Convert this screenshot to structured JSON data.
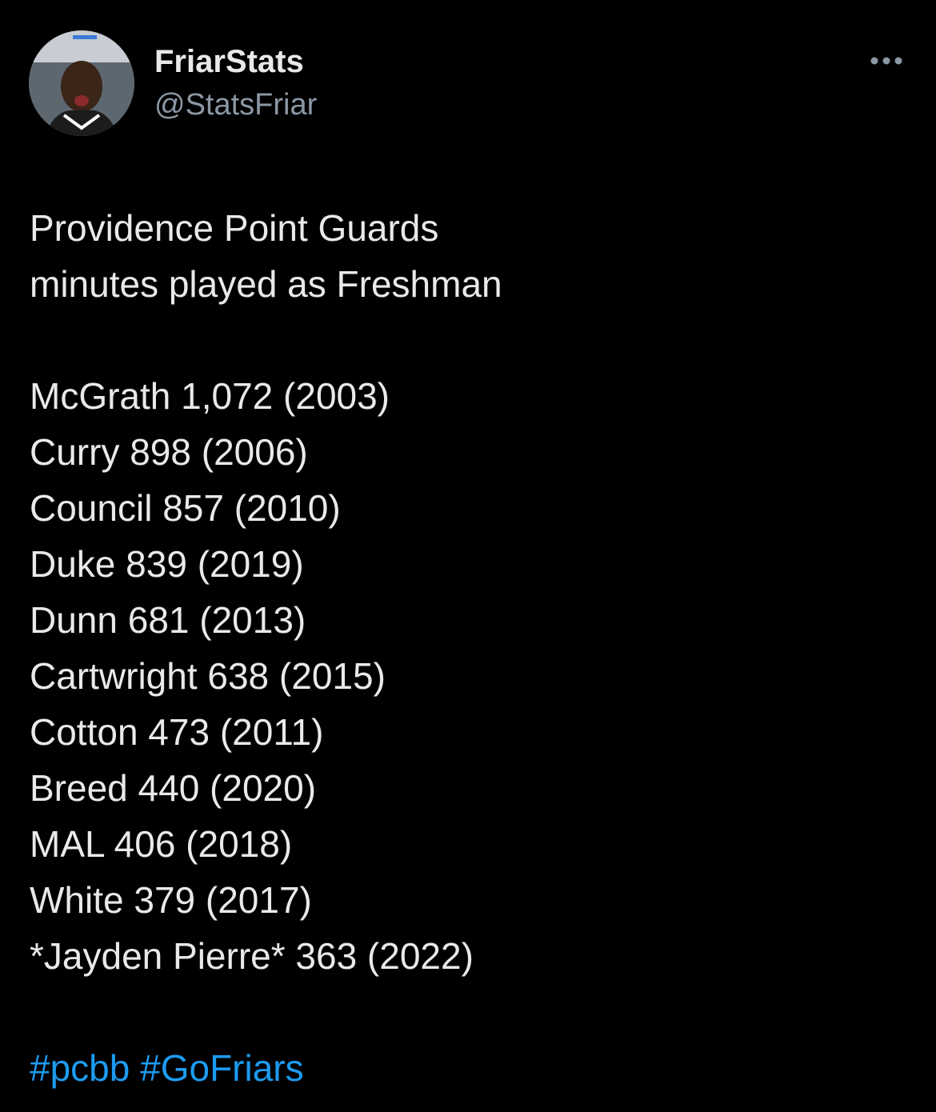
{
  "author": {
    "display_name": "FriarStats",
    "handle": "@StatsFriar",
    "avatar_icon": "profile-photo"
  },
  "more_icon": "more-horizontal-icon",
  "tweet": {
    "heading": [
      "Providence Point Guards",
      "minutes played as Freshman"
    ],
    "stats": [
      "McGrath 1,072 (2003)",
      "Curry 898 (2006)",
      "Council 857 (2010)",
      "Duke 839 (2019)",
      "Dunn 681 (2013)",
      "Cartwright 638 (2015)",
      "Cotton 473 (2011)",
      "Breed 440 (2020)",
      "MAL 406 (2018)",
      "White 379 (2017)",
      "*Jayden Pierre* 363 (2022)"
    ],
    "hashtags": [
      "#pcbb",
      "#GoFriars"
    ]
  },
  "colors": {
    "background": "#000000",
    "text": "#e7e9ea",
    "secondary_text": "#8b98a5",
    "link": "#1d9bf0"
  }
}
